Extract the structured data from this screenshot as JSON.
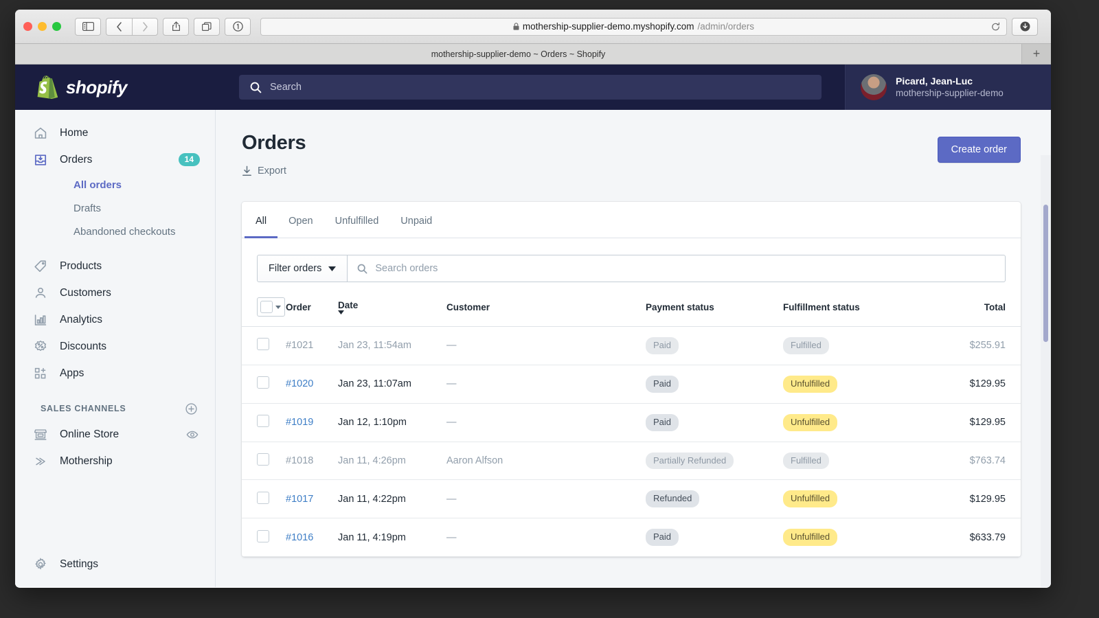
{
  "browser": {
    "traffic_lights": [
      "close",
      "minimize",
      "maximize"
    ],
    "toolbar_buttons": [
      "sidebar-toggle",
      "back",
      "forward",
      "share",
      "tab-overview",
      "onepassword"
    ],
    "url_domain": "mothership-supplier-demo.myshopify.com",
    "url_path": "/admin/orders",
    "lock_glyph": "■",
    "reload_glyph": "↻",
    "download_glyph": "⬇",
    "tab_title": "mothership-supplier-demo ~ Orders ~ Shopify",
    "new_tab_glyph": "+"
  },
  "topbar": {
    "brand_name": "shopify",
    "search_placeholder": "Search",
    "user_name": "Picard, Jean-Luc",
    "user_shop": "mothership-supplier-demo"
  },
  "sidebar": {
    "items": [
      {
        "label": "Home",
        "icon": "home-icon",
        "badge": ""
      },
      {
        "label": "Orders",
        "icon": "orders-icon",
        "badge": "14"
      },
      {
        "label": "Products",
        "icon": "products-tag-icon",
        "badge": ""
      },
      {
        "label": "Customers",
        "icon": "customers-person-icon",
        "badge": ""
      },
      {
        "label": "Analytics",
        "icon": "analytics-bars-icon",
        "badge": ""
      },
      {
        "label": "Discounts",
        "icon": "discounts-percent-icon",
        "badge": ""
      },
      {
        "label": "Apps",
        "icon": "apps-grid-icon",
        "badge": ""
      }
    ],
    "orders_subnav": [
      {
        "label": "All orders",
        "active": true
      },
      {
        "label": "Drafts",
        "active": false
      },
      {
        "label": "Abandoned checkouts",
        "active": false
      }
    ],
    "sales_channels_heading": "SALES CHANNELS",
    "sales_channels": [
      {
        "label": "Online Store",
        "icon": "storefront-icon",
        "trailing_icon": "eye-icon"
      },
      {
        "label": "Mothership",
        "icon": "mothership-arrow-icon",
        "trailing_icon": ""
      }
    ],
    "settings_label": "Settings"
  },
  "main": {
    "page_title": "Orders",
    "export_label": "Export",
    "create_order_label": "Create order",
    "tabs": [
      {
        "label": "All",
        "active": true
      },
      {
        "label": "Open",
        "active": false
      },
      {
        "label": "Unfulfilled",
        "active": false
      },
      {
        "label": "Unpaid",
        "active": false
      }
    ],
    "filter_button_label": "Filter orders",
    "search_placeholder": "Search orders",
    "columns": {
      "order": "Order",
      "date": "Date",
      "customer": "Customer",
      "payment_status": "Payment status",
      "fulfillment_status": "Fulfillment status",
      "total": "Total"
    },
    "sort_column": "Date",
    "rows": [
      {
        "order": "#1021",
        "date": "Jan 23, 11:54am",
        "customer": "—",
        "payment": "Paid",
        "payment_tone": "grey",
        "fulfillment": "Fulfilled",
        "fulfillment_tone": "grey",
        "total": "$255.91",
        "muted": true
      },
      {
        "order": "#1020",
        "date": "Jan 23, 11:07am",
        "customer": "—",
        "payment": "Paid",
        "payment_tone": "grey",
        "fulfillment": "Unfulfilled",
        "fulfillment_tone": "yellow",
        "total": "$129.95",
        "muted": false
      },
      {
        "order": "#1019",
        "date": "Jan 12, 1:10pm",
        "customer": "—",
        "payment": "Paid",
        "payment_tone": "grey",
        "fulfillment": "Unfulfilled",
        "fulfillment_tone": "yellow",
        "total": "$129.95",
        "muted": false
      },
      {
        "order": "#1018",
        "date": "Jan 11, 4:26pm",
        "customer": "Aaron Alfson",
        "payment": "Partially Refunded",
        "payment_tone": "grey",
        "fulfillment": "Fulfilled",
        "fulfillment_tone": "grey",
        "total": "$763.74",
        "muted": true
      },
      {
        "order": "#1017",
        "date": "Jan 11, 4:22pm",
        "customer": "—",
        "payment": "Refunded",
        "payment_tone": "grey",
        "fulfillment": "Unfulfilled",
        "fulfillment_tone": "yellow",
        "total": "$129.95",
        "muted": false
      },
      {
        "order": "#1016",
        "date": "Jan 11, 4:19pm",
        "customer": "—",
        "payment": "Paid",
        "payment_tone": "grey",
        "fulfillment": "Unfulfilled",
        "fulfillment_tone": "yellow",
        "total": "$633.79",
        "muted": false
      }
    ]
  },
  "colors": {
    "nav_dark": "#1a1d40",
    "accent_indigo": "#5c6ac4",
    "badge_teal": "#47c1bf",
    "pill_yellow": "#ffea8a",
    "pill_grey": "#dfe3e8",
    "link_blue": "#3e7ec6",
    "page_bg": "#f4f6f8"
  }
}
